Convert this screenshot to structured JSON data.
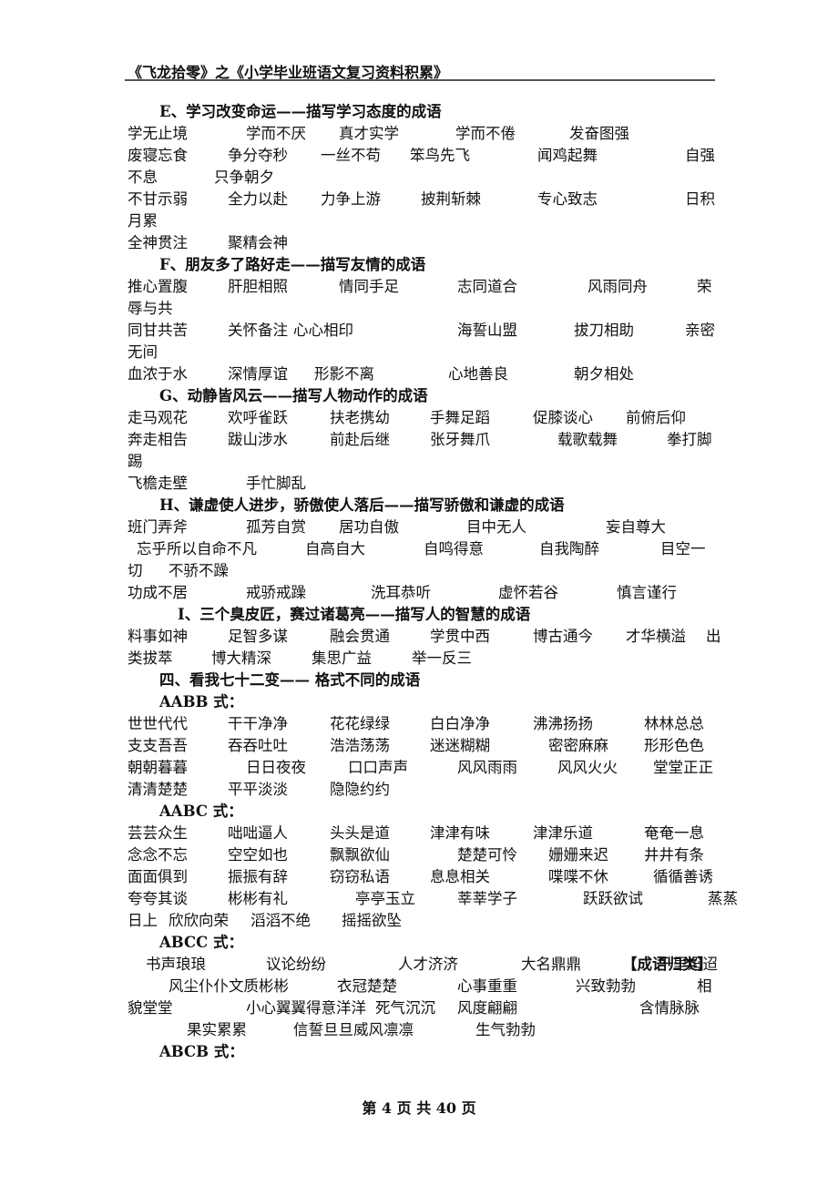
{
  "header": {
    "title": "《飞龙拾零》之《小学毕业班语文复习资料积累》"
  },
  "sections": {
    "E": {
      "heading": "E、学习改变命运——描写学习态度的成语",
      "lines": [
        [
          "学无止境",
          "学而不厌",
          "真才实学",
          "学而不倦",
          "发奋图强"
        ],
        [
          "废寝忘食",
          "争分夺秒",
          "一丝不苟",
          "笨鸟先飞",
          "闻鸡起舞",
          "自强"
        ],
        [
          "不息",
          "只争朝夕"
        ],
        [
          "不甘示弱",
          "全力以赴",
          "力争上游",
          "披荆斩棘",
          "专心致志",
          "日积"
        ],
        [
          "月累"
        ],
        [
          "全神贯注",
          "聚精会神"
        ]
      ]
    },
    "F": {
      "heading": "F、朋友多了路好走——描写友情的成语",
      "lines": [
        [
          "推心置腹",
          "肝胆相照",
          "情同手足",
          "志同道合",
          "风雨同舟",
          "荣"
        ],
        [
          "辱与共"
        ],
        [
          "同甘共苦",
          "关怀备注",
          "心心相印",
          "海誓山盟",
          "拔刀相助",
          "亲密"
        ],
        [
          "无间"
        ],
        [
          "血浓于水",
          "深情厚谊",
          "形影不离",
          "心地善良",
          "朝夕相处"
        ]
      ]
    },
    "G": {
      "heading": "G、动静皆风云——描写人物动作的成语",
      "lines": [
        [
          "走马观花",
          "欢呼雀跃",
          "扶老携幼",
          "手舞足蹈",
          "促膝谈心",
          "前俯后仰"
        ],
        [
          "奔走相告",
          "跋山涉水",
          "前赴后继",
          "张牙舞爪",
          "载歌载舞",
          "拳打脚"
        ],
        [
          "踢"
        ],
        [
          "飞檐走壁",
          "手忙脚乱"
        ]
      ]
    },
    "H": {
      "heading": "H、谦虚使人进步，骄傲使人落后——描写骄傲和谦虚的成语",
      "lines": [
        [
          "班门弄斧",
          "孤芳自赏",
          "居功自傲",
          "目中无人",
          "妄自尊大"
        ],
        [
          "忘乎所以自命不凡",
          "自高自大",
          "自鸣得意",
          "自我陶醉",
          "目空一"
        ],
        [
          "切",
          "不骄不躁"
        ],
        [
          "功成不居",
          "戒骄戒躁",
          "洗耳恭听",
          "虚怀若谷",
          "慎言谨行"
        ]
      ]
    },
    "I": {
      "heading": "I、三个臭皮匠，赛过诸葛亮——描写人的智慧的成语",
      "lines": [
        [
          "料事如神",
          "足智多谋",
          "融会贯通",
          "学贯中西",
          "博古通今",
          "才华横溢",
          "出"
        ],
        [
          "类拔萃",
          "博大精深",
          "集思广益",
          "举一反三"
        ]
      ]
    },
    "four": {
      "heading": "四、看我七十二变—— 格式不同的成语"
    },
    "AABB": {
      "heading": "AABB 式：",
      "lines": [
        [
          "世世代代",
          "干干净净",
          "花花绿绿",
          "白白净净",
          "沸沸扬扬",
          "林林总总"
        ],
        [
          "支支吾吾",
          "吞吞吐吐",
          "浩浩荡荡",
          "迷迷糊糊",
          "密密麻麻",
          "形形色色"
        ],
        [
          "朝朝暮暮",
          "日日夜夜",
          "口口声声",
          "风风雨雨",
          "风风火火",
          "堂堂正正"
        ],
        [
          "清清楚楚",
          "平平淡淡",
          "隐隐约约"
        ]
      ]
    },
    "AABC": {
      "heading": "AABC 式：",
      "lines": [
        [
          "芸芸众生",
          "咄咄逼人",
          "头头是道",
          "津津有味",
          "津津乐道",
          "奄奄一息"
        ],
        [
          "念念不忘",
          "空空如也",
          "飘飘欲仙",
          "楚楚可怜",
          "姗姗来迟",
          "井井有条"
        ],
        [
          "面面俱到",
          "振振有辞",
          "窃窃私语",
          "息息相关",
          "喋喋不休",
          "循循善诱"
        ],
        [
          "夸夸其谈",
          "彬彬有礼",
          "亭亭玉立",
          "莘莘学子",
          "跃跃欲试",
          "蒸蒸"
        ],
        [
          "日上",
          "欣欣向荣",
          "滔滔不绝",
          "摇摇欲坠"
        ]
      ]
    },
    "ABCC": {
      "heading": "ABCC 式：",
      "tag": "【成语归类】",
      "lines": [
        [
          "书声琅琅",
          "议论纷纷",
          "人才济济",
          "大名鼎鼎",
          "千里迢迢"
        ],
        [
          "风尘仆仆文质彬彬",
          "衣冠楚楚",
          "心事重重",
          "兴致勃勃",
          "相"
        ],
        [
          "貌堂堂",
          "小心翼翼得意洋洋",
          "死气沉沉",
          "风度翩翩",
          "含情脉脉"
        ],
        [
          "果实累累",
          "信誓旦旦威风凛凛",
          "生气勃勃"
        ]
      ]
    },
    "ABCB": {
      "heading": "ABCB 式："
    }
  },
  "footer": {
    "page_label": "第 4 页 共 40 页"
  }
}
